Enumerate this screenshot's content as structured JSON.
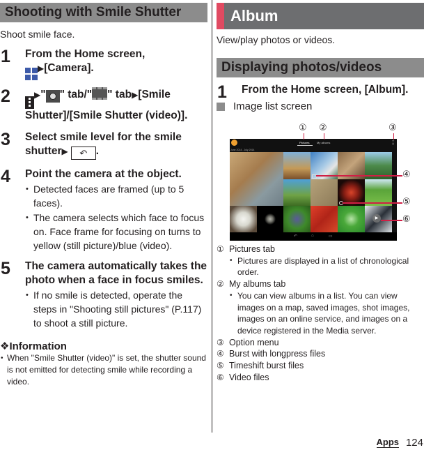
{
  "left": {
    "heading": "Shooting with Smile Shutter",
    "lead": "Shoot smile face.",
    "steps": [
      {
        "num": "1",
        "line1": "From the Home screen,",
        "icon": "apps-grid-icon",
        "line2": "[Camera]."
      },
      {
        "num": "2",
        "pre": "\"",
        "mid1": "\" tab/\"",
        "mid2": "\" tab",
        "post": "[Smile Shutter]/[Smile Shutter (video)]."
      },
      {
        "num": "3",
        "text": "Select smile level for the smile shutter",
        "end": "."
      },
      {
        "num": "4",
        "title": "Point the camera at the object.",
        "bullets": [
          "Detected faces are framed (up to 5 faces).",
          "The camera selects which face to focus on. Face frame for focusing on turns to yellow (still picture)/blue (video)."
        ]
      },
      {
        "num": "5",
        "title": "The camera automatically takes the photo when a face in focus smiles.",
        "bullets": [
          "If no smile is detected, operate the steps in \"Shooting still pictures\" (P.117) to shoot a still picture."
        ]
      }
    ],
    "info": {
      "heading": "❖Information",
      "bullets": [
        "When \"Smile Shutter (video)\" is set, the shutter sound is not emitted for detecting smile while recording a video."
      ]
    }
  },
  "right": {
    "heading": "Album",
    "lead": "View/play photos or videos.",
    "subheading": "Displaying photos/videos",
    "step1": {
      "num": "1",
      "title": "From the Home screen, [Album]."
    },
    "screen_label": "Image list screen",
    "screenshot": {
      "tab_pictures": "Pictures",
      "tab_albums": "My albums",
      "date_range": "June 2014 - July 2014",
      "nav_back": "↶",
      "nav_home": "⌂",
      "nav_recent": "▭"
    },
    "callouts": [
      "①",
      "②",
      "③",
      "④",
      "⑤",
      "⑥"
    ],
    "legend": [
      {
        "num": "①",
        "label": "Pictures tab",
        "bullets": [
          "Pictures are displayed in a list of chronological order."
        ]
      },
      {
        "num": "②",
        "label": "My albums tab",
        "bullets": [
          "You can view albums in a list. You can view images on a map, saved images, shot images, images on an online service, and images on a device registered in the Media server."
        ]
      },
      {
        "num": "③",
        "label": "Option menu",
        "bullets": []
      },
      {
        "num": "④",
        "label": "Burst with longpress files",
        "bullets": []
      },
      {
        "num": "⑤",
        "label": "Timeshift burst files",
        "bullets": []
      },
      {
        "num": "⑥",
        "label": "Video files",
        "bullets": []
      }
    ]
  },
  "footer": {
    "section": "Apps",
    "page": "124"
  },
  "colors": {
    "accent": "#e04a61",
    "main_heading_bg": "#6d6e70",
    "sub_heading_bg": "#8c8c8c",
    "callout_line": "#d01f45"
  }
}
